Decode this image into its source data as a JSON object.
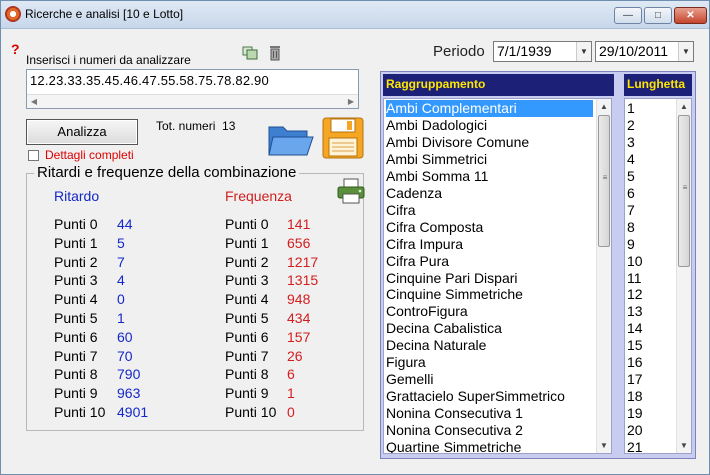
{
  "window": {
    "title": "Ricerche e analisi [10 e Lotto]",
    "controls": {
      "minimize": "—",
      "maximize": "□",
      "close": "✕"
    }
  },
  "input": {
    "help_glyph": "?",
    "label": "Inserisci i numeri da analizzare",
    "value": "12.23.33.35.45.46.47.55.58.75.78.82.90",
    "icons": [
      "copy-icon",
      "trash-icon"
    ]
  },
  "actions": {
    "analizza_label": "Analizza",
    "tot_label": "Tot. numeri",
    "tot_value": "13",
    "details_label": "Dettagli completi",
    "details_checked": false
  },
  "stats": {
    "title": "Ritardi e frequenze della combinazione",
    "ritardo_header": "Ritardo",
    "frequenza_header": "Frequenza",
    "ritardo": [
      {
        "label": "Punti 0",
        "value": "44"
      },
      {
        "label": "Punti 1",
        "value": "5"
      },
      {
        "label": "Punti 2",
        "value": "7"
      },
      {
        "label": "Punti 3",
        "value": "4"
      },
      {
        "label": "Punti 4",
        "value": "0"
      },
      {
        "label": "Punti 5",
        "value": "1"
      },
      {
        "label": "Punti 6",
        "value": "60"
      },
      {
        "label": "Punti 7",
        "value": "70"
      },
      {
        "label": "Punti 8",
        "value": "790"
      },
      {
        "label": "Punti 9",
        "value": "963"
      },
      {
        "label": "Punti 10",
        "value": "4901"
      }
    ],
    "frequenza": [
      {
        "label": "Punti 0",
        "value": "141"
      },
      {
        "label": "Punti 1",
        "value": "656"
      },
      {
        "label": "Punti 2",
        "value": "1217"
      },
      {
        "label": "Punti 3",
        "value": "1315"
      },
      {
        "label": "Punti 4",
        "value": "948"
      },
      {
        "label": "Punti 5",
        "value": "434"
      },
      {
        "label": "Punti 6",
        "value": "157"
      },
      {
        "label": "Punti 7",
        "value": "26"
      },
      {
        "label": "Punti 8",
        "value": "6"
      },
      {
        "label": "Punti 9",
        "value": "1"
      },
      {
        "label": "Punti 10",
        "value": "0"
      }
    ]
  },
  "periodo": {
    "label": "Periodo",
    "from": "7/1/1939",
    "to": "29/10/2011"
  },
  "raggruppamento": {
    "header": "Raggruppamento",
    "selected": "Ambi Complementari",
    "items": [
      "Ambi Complementari",
      "Ambi Dadologici",
      "Ambi Divisore Comune",
      "Ambi Simmetrici",
      "Ambi Somma 11",
      "Cadenza",
      "Cifra",
      "Cifra Composta",
      "Cifra Impura",
      "Cifra Pura",
      "Cinquine Pari Dispari",
      "Cinquine Simmetriche",
      "ControFigura",
      "Decina Cabalistica",
      "Decina Naturale",
      "Figura",
      "Gemelli",
      "Grattacielo SuperSimmetrico",
      "Nonina Consecutiva 1",
      "Nonina Consecutiva 2",
      "Quartine Simmetriche"
    ]
  },
  "lunghetta": {
    "header": "Lunghetta",
    "items": [
      "1",
      "2",
      "3",
      "4",
      "5",
      "6",
      "7",
      "8",
      "9",
      "10",
      "11",
      "12",
      "13",
      "14",
      "15",
      "16",
      "17",
      "18",
      "19",
      "20",
      "21"
    ]
  },
  "colors": {
    "list_header_bg": "#1c2077",
    "list_header_fg": "#ffe600",
    "panel_bg": "#c8ccf0",
    "selection": "#3399ff",
    "ritardo_values": "#1428c8",
    "frequenza_values": "#d21e1e"
  }
}
